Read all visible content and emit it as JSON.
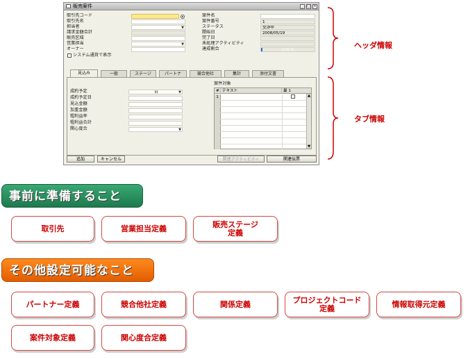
{
  "window": {
    "title": "販売案件",
    "left_fields": [
      {
        "label": "取引先コード",
        "value": ""
      },
      {
        "label": "取引先名",
        "value": ""
      },
      {
        "label": "担当者",
        "value": ""
      },
      {
        "label": "請求金額合計",
        "value": ""
      },
      {
        "label": "販売区域",
        "value": ""
      },
      {
        "label": "営業担当",
        "value": ""
      },
      {
        "label": "オーナー",
        "value": ""
      }
    ],
    "checkbox_label": "システム通貨で表示",
    "right_fields": [
      {
        "label": "案件名",
        "value": ""
      },
      {
        "label": "案件番号",
        "value": "1"
      },
      {
        "label": "ステータス",
        "value": "交渉中"
      },
      {
        "label": "開始日",
        "value": "2008/05/19"
      },
      {
        "label": "完了日",
        "value": ""
      },
      {
        "label": "未処理アクティビティ",
        "value": ""
      },
      {
        "label": "達成割合",
        "value": "0.00 %"
      }
    ],
    "progress_fraction": 0.02,
    "tabs": [
      {
        "label": "見込み"
      },
      {
        "label": "一般"
      },
      {
        "label": "ステージ"
      },
      {
        "label": "パートナ"
      },
      {
        "label": "競合他社"
      },
      {
        "label": "集計"
      },
      {
        "label": "添付文書"
      }
    ],
    "tab_fields": [
      {
        "label": "成約予定",
        "value": "日"
      },
      {
        "label": "成約予定日",
        "value": ""
      },
      {
        "label": "見込金額",
        "value": ""
      },
      {
        "label": "加重金額",
        "value": ""
      },
      {
        "label": "粗利益率",
        "value": ""
      },
      {
        "label": "粗利益合計",
        "value": ""
      },
      {
        "label": "関心度合",
        "value": ""
      }
    ],
    "grid": {
      "title": "案件対象",
      "col_index": "#",
      "col_text": "テキスト",
      "col_flag": "最 1",
      "rows": [
        "1",
        "",
        "",
        "",
        "",
        "",
        "",
        "",
        ""
      ]
    },
    "buttons": {
      "add": "追加",
      "cancel": "キャンセル",
      "related_activity": "関連アクティビティ",
      "related_docs": "関連伝票"
    }
  },
  "annotations": {
    "header": "ヘッダ情報",
    "tab": "タブ情報"
  },
  "section1": {
    "title": "事前に準備すること",
    "cards": [
      "取引先",
      "営業担当定義",
      "販売ステージ\n定義"
    ]
  },
  "section2": {
    "title": "その他設定可能なこと",
    "cards_row1": [
      "パートナー定義",
      "競合他社定義",
      "関係定義",
      "プロジェクトコード\n定義",
      "情報取得元定義"
    ],
    "cards_row2": [
      "案件対象定義",
      "関心度合定義"
    ]
  },
  "colors": {
    "annotation_red": "#cc0000",
    "heading_green": "#1d7a4e",
    "heading_orange": "#e25d00",
    "field_yellow": "#fde88a"
  }
}
